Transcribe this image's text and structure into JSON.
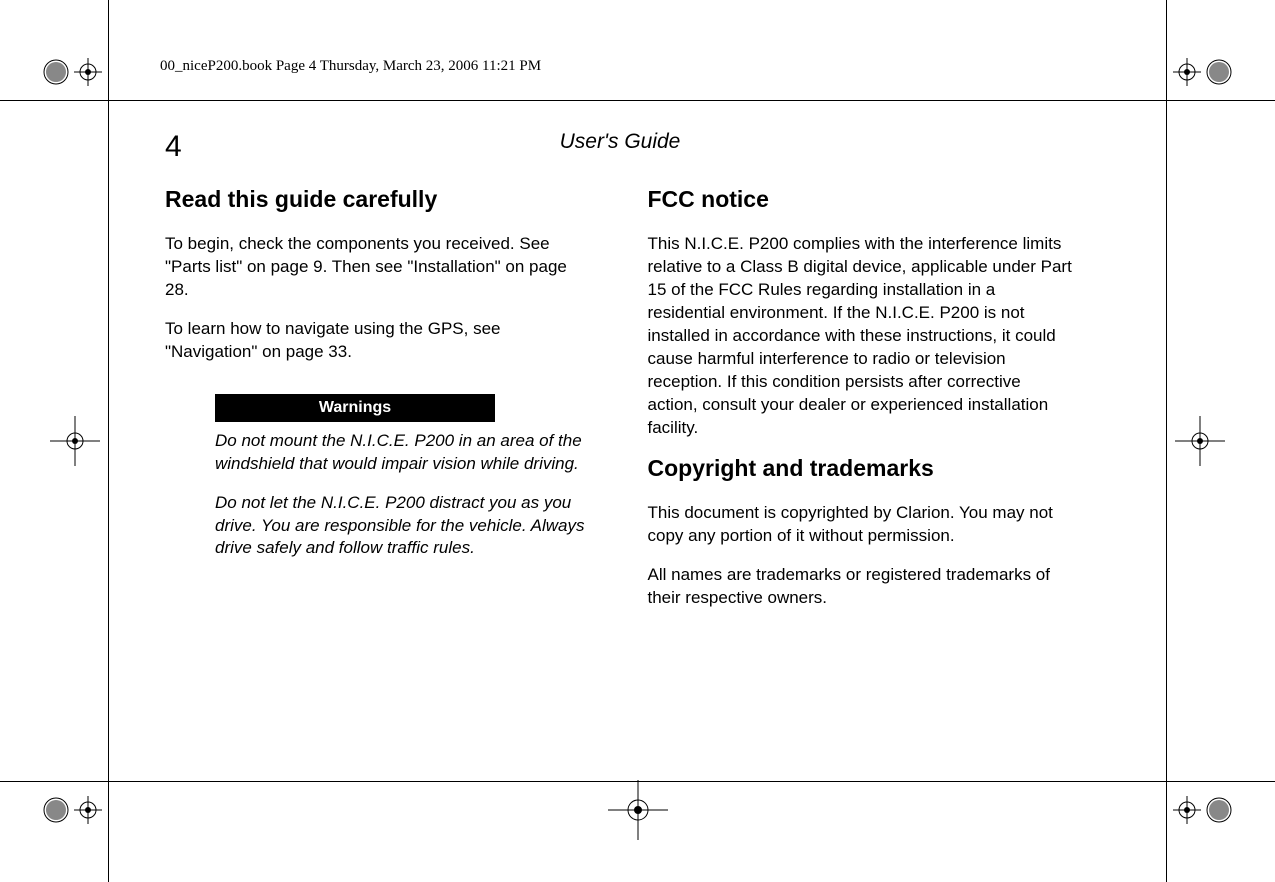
{
  "header": {
    "filename_info": "00_niceP200.book  Page 4  Thursday, March 23, 2006  11:21 PM"
  },
  "page": {
    "number": "4",
    "guide_title": "User's Guide"
  },
  "left_column": {
    "heading": "Read this guide carefully",
    "para1": "To begin, check the components you received. See \"Parts list\" on page 9. Then see \"Installation\" on page 28.",
    "para2": "To learn how to navigate using the GPS, see \"Navigation\" on page 33.",
    "warning_label": "Warnings",
    "warning1": "Do not mount the N.I.C.E. P200 in an area of the windshield that would impair vision while driving.",
    "warning2": "Do not let the N.I.C.E. P200 distract you as you drive. You are responsible for the vehicle. Always drive safely and follow traffic rules."
  },
  "right_column": {
    "heading1": "FCC notice",
    "para1": "This N.I.C.E. P200 complies with the interference limits relative to a Class B digital device, applicable under Part 15 of the FCC Rules regarding installation in a residential environment. If the N.I.C.E. P200 is not installed in accordance with these instructions, it could cause harmful interference to radio or television reception. If this condition persists after corrective action, consult your dealer or experienced installation facility.",
    "heading2": "Copyright and trademarks",
    "para2": "This document is copyrighted by Clarion. You may not copy any portion of it without permission.",
    "para3": "All names are trademarks or registered trademarks of their respective owners."
  }
}
